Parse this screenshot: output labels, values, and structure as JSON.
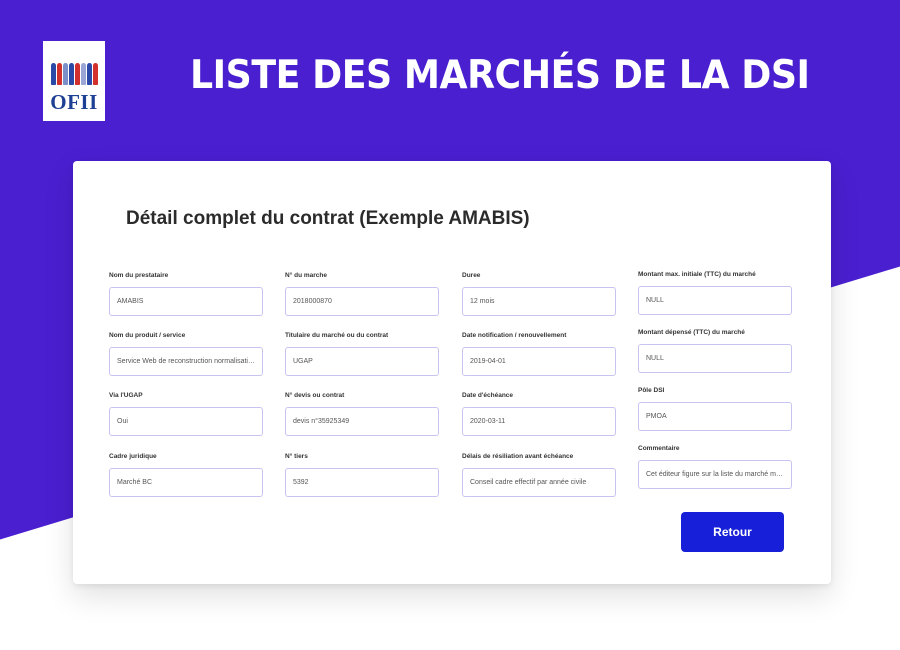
{
  "header": {
    "logo_text": "OFII",
    "title": "LISTE DES MARCHÉS DE LA DSI"
  },
  "card": {
    "title": "Détail complet du contrat (Exemple AMABIS)",
    "fields": {
      "nom_prestataire": {
        "label": "Nom du prestataire",
        "value": "AMABIS"
      },
      "num_marche": {
        "label": "N° du marche",
        "value": "2018000870"
      },
      "duree": {
        "label": "Duree",
        "value": "12 mois"
      },
      "montant_initial": {
        "label": "Montant max. initiale (TTC) du marché",
        "value": "NULL"
      },
      "nom_produit": {
        "label": "Nom du produit / service",
        "value": "Service Web de reconstruction normalisation va..."
      },
      "titulaire": {
        "label": "Titulaire du marché ou du contrat",
        "value": "UGAP"
      },
      "date_notification": {
        "label": "Date notification / renouvellement",
        "value": "2019-04-01"
      },
      "montant_depense": {
        "label": "Montant dépensé (TTC) du marché",
        "value": "NULL"
      },
      "via_ugap": {
        "label": "Via l'UGAP",
        "value": "Oui"
      },
      "num_devis": {
        "label": "N° devis ou contrat",
        "value": "devis n°35925349"
      },
      "date_echeance": {
        "label": "Date d'échéance",
        "value": "2020-03-11"
      },
      "pole_dsi": {
        "label": "Pôle DSI",
        "value": "PMOA"
      },
      "cadre_juridique": {
        "label": "Cadre juridique",
        "value": "Marché BC"
      },
      "num_tiers": {
        "label": "N° tiers",
        "value": "5392"
      },
      "delais_resiliation": {
        "label": "Délais de résiliation avant échéance",
        "value": "Conseil cadre effectif par année civile"
      },
      "commentaire": {
        "label": "Commentaire",
        "value": "Cet éditeur figure sur la liste du marché multi-édi..."
      }
    },
    "retour_label": "Retour"
  },
  "colors": {
    "header_bg": "#4a1fd0",
    "button_bg": "#1720d8",
    "input_border": "#c8c4f2"
  }
}
